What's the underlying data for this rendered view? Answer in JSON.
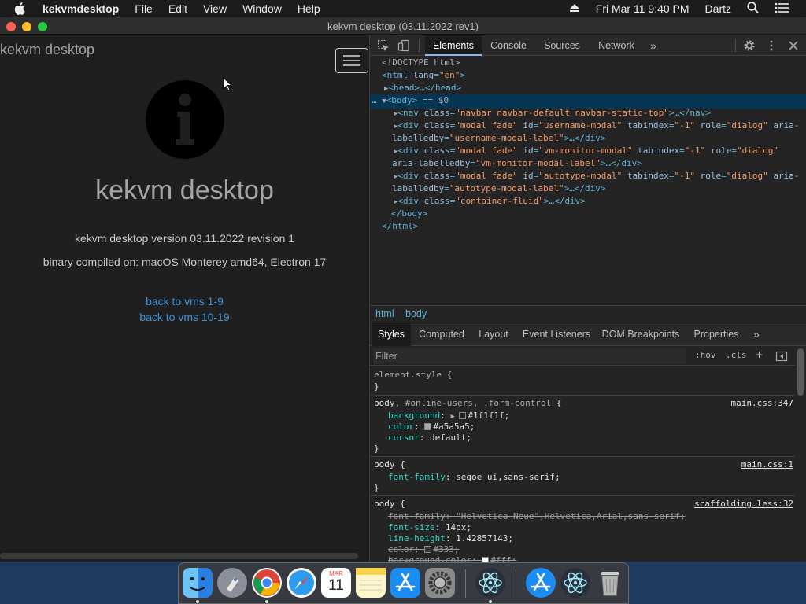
{
  "menubar": {
    "app_name": "kekvmdesktop",
    "items": [
      "File",
      "Edit",
      "View",
      "Window",
      "Help"
    ],
    "datetime": "Fri Mar 11  9:40 PM",
    "user": "Dartz"
  },
  "window": {
    "title": "kekvm desktop (03.11.2022 rev1)"
  },
  "app": {
    "brand": "kekvm desktop",
    "heading": "kekvm desktop",
    "version_text": "kekvm desktop version 03.11.2022 revision 1",
    "compiled_text": "binary compiled on: macOS Monterey amd64, Electron 17",
    "link_1": "back to vms 1-9",
    "link_2": "back to vms 10-19"
  },
  "devtools": {
    "tabs": [
      "Elements",
      "Console",
      "Sources",
      "Network"
    ],
    "active_tab": "Elements",
    "more": "»",
    "dom": {
      "doctype": "<!DOCTYPE html>",
      "html_open": "<html",
      "html_lang_attr": "lang",
      "html_lang_val": "\"en\"",
      "html_close_bracket": ">",
      "head": "<head>…</head>",
      "body_open": "<body>",
      "body_marker": " == $0",
      "ellipsis": "…",
      "nav_tag": "<nav",
      "nav_class_attr": "class",
      "nav_class_val": "\"navbar navbar-default navbar-static-top\"",
      "nav_end": ">…</nav>",
      "div1_id": "\"username-modal\"",
      "div1_label": "\"username-modal-label\"",
      "div2_id": "\"vm-monitor-modal\"",
      "div2_label": "\"vm-monitor-modal-label\"",
      "div3_id": "\"autotype-modal\"",
      "div3_label": "\"autotype-modal-label\"",
      "div_tag": "<div",
      "class_attr": "class",
      "modal_class_val": "\"modal fade\"",
      "id_attr": "id",
      "tabindex_attr": "tabindex",
      "tabindex_val": "\"-1\"",
      "role_attr": "role",
      "role_val": "\"dialog\"",
      "aria_attr_a": "aria-",
      "aria_attr_b": "labelledby",
      "aria_attr_full": "aria-labelledby",
      "div_end": ">…</div>",
      "container_class_val": "\"container-fluid\"",
      "body_close": "</body>",
      "html_close": "</html>"
    },
    "breadcrumb": [
      "html",
      "body"
    ],
    "styles_tabs": [
      "Styles",
      "Computed",
      "Layout",
      "Event Listeners",
      "DOM Breakpoints",
      "Properties"
    ],
    "filter_placeholder": "Filter",
    "hov": ":hov",
    "cls": ".cls",
    "plus": "+",
    "rules": {
      "r0_selector": "element.style {",
      "close_brace": "}",
      "r1_selector_main": "body,",
      "r1_selector_dim": " #online-users, .form-control",
      "open_brace": " {",
      "r1_src": "main.css:347",
      "r1_p1": "background",
      "r1_v1": "#1f1f1f;",
      "r1_p2": "color",
      "r1_v2": "#a5a5a5;",
      "r1_p3": "cursor",
      "r1_v3": "default;",
      "r2_selector": "body {",
      "r2_src": "main.css:1",
      "r2_p1": "font-family",
      "r2_v1": "segoe ui,sans-serif;",
      "r3_selector": "body {",
      "r3_src": "scaffolding.less:32",
      "r3_p1": "font-family",
      "r3_v1": "\"Helvetica Neue\",Helvetica,Arial,sans-serif;",
      "r3_p2": "font-size",
      "r3_v2": "14px;",
      "r3_p3": "line-height",
      "r3_v3": "1.42857143;",
      "r3_p4": "color",
      "r3_v4": "#333;",
      "r3_p5": "background-color",
      "r3_v5": "#fff;",
      "colon": ": "
    }
  },
  "colors": {
    "swatch_bg": "#1f1f1f",
    "swatch_color": "#a5a5a5",
    "swatch_333": "#333333",
    "swatch_fff": "#ffffff"
  },
  "dock": {
    "icons": [
      "finder-icon",
      "launchpad-icon",
      "chrome-icon",
      "safari-icon",
      "calendar-icon",
      "notes-icon",
      "app-store-icon",
      "system-preferences-icon",
      "electron-icon",
      "app-store-icon",
      "electron-icon",
      "trash-icon"
    ],
    "calendar_month": "MAR",
    "calendar_day": "11"
  }
}
